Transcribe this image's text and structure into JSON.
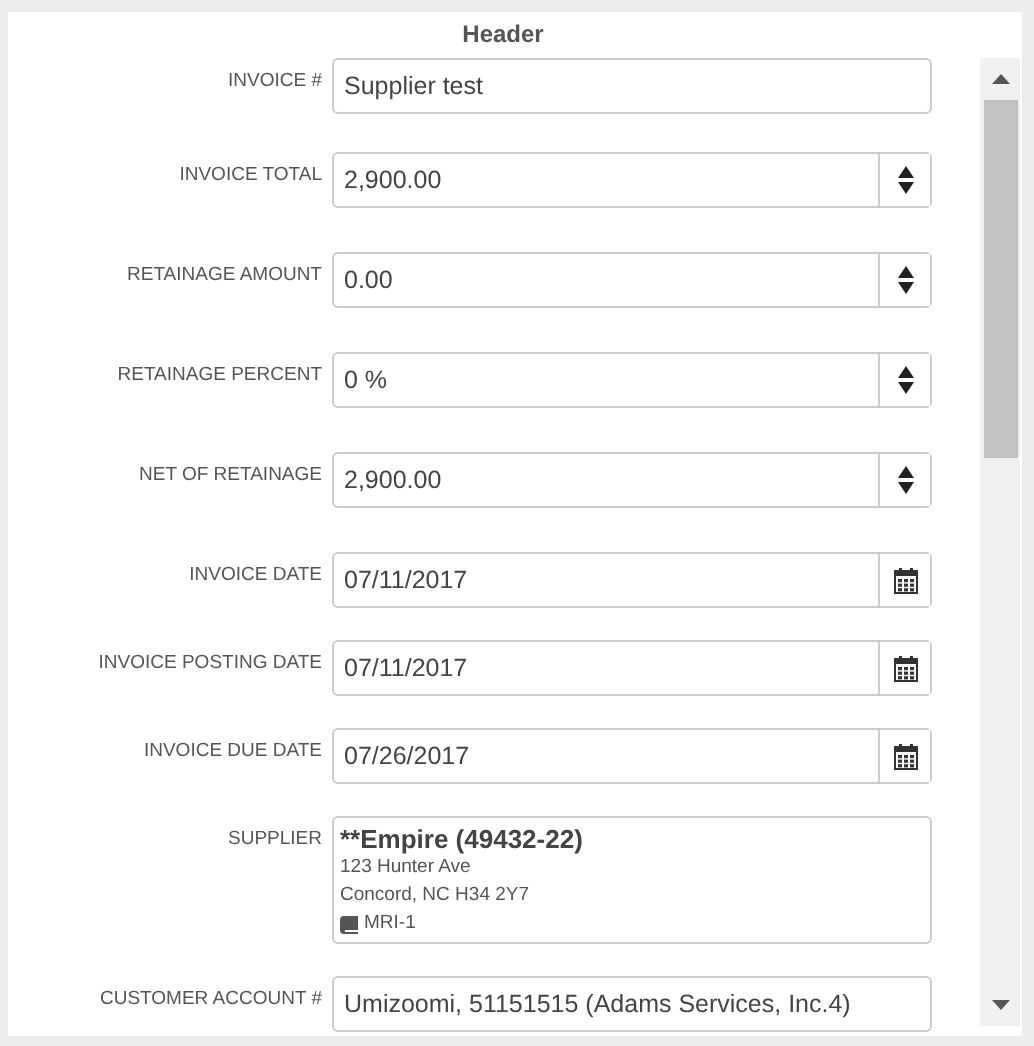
{
  "section": {
    "title": "Header"
  },
  "fields": [
    {
      "kind": "text",
      "label": "INVOICE #",
      "value": "Supplier test"
    },
    {
      "kind": "spinner",
      "label": "INVOICE TOTAL",
      "value": "2,900.00"
    },
    {
      "kind": "spinner",
      "label": "RETAINAGE AMOUNT",
      "value": "0.00"
    },
    {
      "kind": "spinner",
      "label": "RETAINAGE PERCENT",
      "value": "0 %"
    },
    {
      "kind": "spinner",
      "label": "NET OF RETAINAGE",
      "value": "2,900.00"
    },
    {
      "kind": "date",
      "label": "INVOICE DATE",
      "value": "07/11/2017"
    },
    {
      "kind": "date",
      "label": "INVOICE POSTING DATE",
      "value": "07/11/2017"
    },
    {
      "kind": "date",
      "label": "INVOICE DUE DATE",
      "value": "07/26/2017"
    },
    {
      "kind": "supplier",
      "label": "SUPPLIER",
      "name": "**Empire (49432-22)",
      "address_1": "123 Hunter Ave",
      "address_2": "Concord, NC H34 2Y7",
      "code": "MRI-1"
    },
    {
      "kind": "text",
      "label": "CUSTOMER ACCOUNT #",
      "value": "Umizoomi, 51151515 (Adams Services, Inc.4)"
    }
  ]
}
